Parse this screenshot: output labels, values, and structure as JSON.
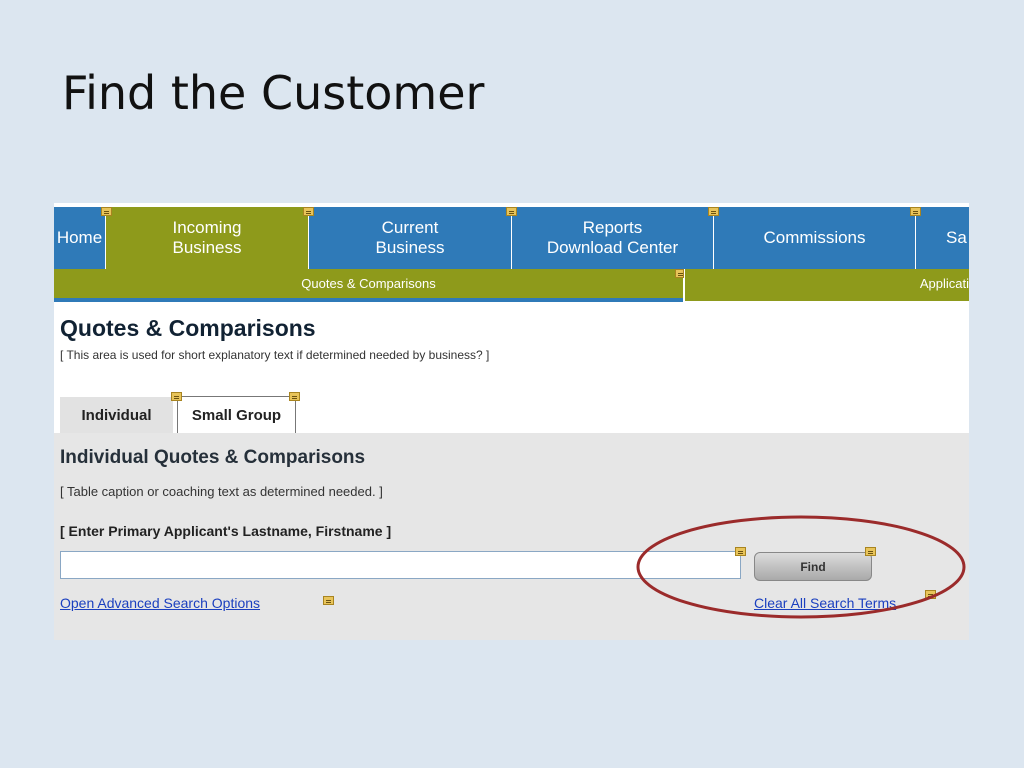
{
  "slide": {
    "title": "Find the Customer"
  },
  "topnav": {
    "items": [
      {
        "label": "Home"
      },
      {
        "label": "Incoming\nBusiness"
      },
      {
        "label": "Current\nBusiness"
      },
      {
        "label": "Reports\nDownload Center"
      },
      {
        "label": "Commissions"
      },
      {
        "label": "Sa"
      }
    ]
  },
  "subnav": {
    "items": [
      {
        "label": "Quotes & Comparisons"
      },
      {
        "label": "Applicati"
      }
    ]
  },
  "page": {
    "heading": "Quotes & Comparisons",
    "subtext": "[ This area is used for short explanatory text if determined needed by business? ]"
  },
  "tabs": [
    {
      "label": "Individual"
    },
    {
      "label": "Small Group"
    }
  ],
  "panel": {
    "heading": "Individual Quotes & Comparisons",
    "caption": "[ Table caption or coaching text as determined needed. ]",
    "field_label": "[ Enter Primary Applicant's Lastname, Firstname ]",
    "search_value": "",
    "find_label": "Find",
    "advanced_link": "Open Advanced Search Options",
    "clear_link": "Clear All Search Terms"
  },
  "colors": {
    "nav_blue": "#2f7ab8",
    "nav_olive": "#8e9a1b",
    "annotation_red": "#9b2b2b"
  }
}
